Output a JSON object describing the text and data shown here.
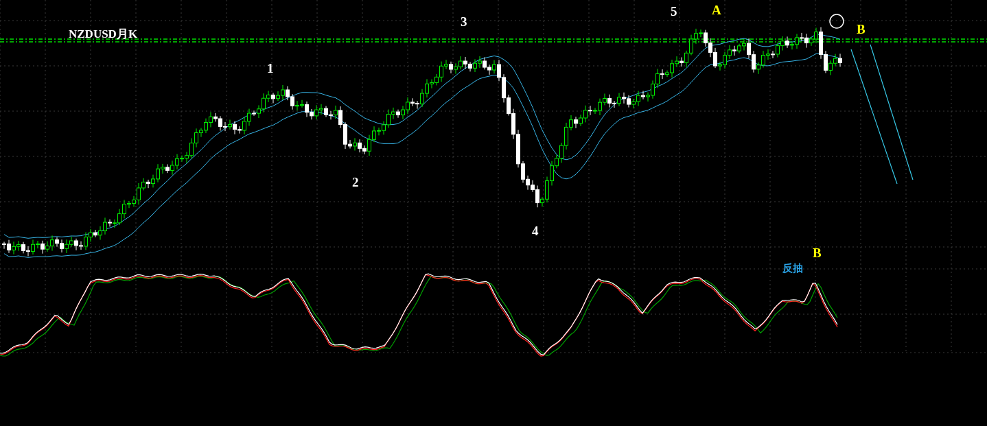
{
  "chart": {
    "title": "NZDUSD月K",
    "wave_labels": [
      {
        "text": "1",
        "color": "#ffffff"
      },
      {
        "text": "2",
        "color": "#ffffff"
      },
      {
        "text": "3",
        "color": "#ffffff"
      },
      {
        "text": "4",
        "color": "#ffffff"
      },
      {
        "text": "5",
        "color": "#ffffff"
      },
      {
        "text": "A",
        "color": "#ffff00"
      },
      {
        "text": "B",
        "color": "#ffff00"
      }
    ]
  },
  "oscillator": {
    "wave_labels": [
      {
        "text": "B",
        "color": "#ffff00"
      }
    ],
    "note": "反抽"
  }
}
